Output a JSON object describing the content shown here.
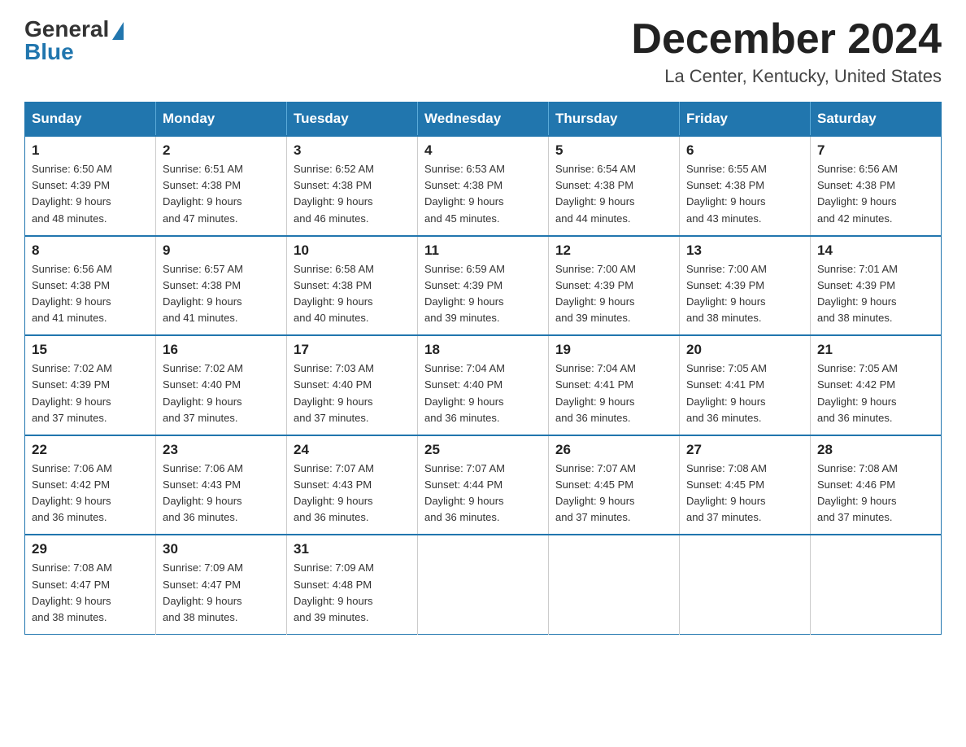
{
  "header": {
    "logo_general": "General",
    "logo_blue": "Blue",
    "title": "December 2024",
    "location": "La Center, Kentucky, United States"
  },
  "days_of_week": [
    "Sunday",
    "Monday",
    "Tuesday",
    "Wednesday",
    "Thursday",
    "Friday",
    "Saturday"
  ],
  "weeks": [
    [
      {
        "day": "1",
        "sunrise": "6:50 AM",
        "sunset": "4:39 PM",
        "daylight": "9 hours and 48 minutes."
      },
      {
        "day": "2",
        "sunrise": "6:51 AM",
        "sunset": "4:38 PM",
        "daylight": "9 hours and 47 minutes."
      },
      {
        "day": "3",
        "sunrise": "6:52 AM",
        "sunset": "4:38 PM",
        "daylight": "9 hours and 46 minutes."
      },
      {
        "day": "4",
        "sunrise": "6:53 AM",
        "sunset": "4:38 PM",
        "daylight": "9 hours and 45 minutes."
      },
      {
        "day": "5",
        "sunrise": "6:54 AM",
        "sunset": "4:38 PM",
        "daylight": "9 hours and 44 minutes."
      },
      {
        "day": "6",
        "sunrise": "6:55 AM",
        "sunset": "4:38 PM",
        "daylight": "9 hours and 43 minutes."
      },
      {
        "day": "7",
        "sunrise": "6:56 AM",
        "sunset": "4:38 PM",
        "daylight": "9 hours and 42 minutes."
      }
    ],
    [
      {
        "day": "8",
        "sunrise": "6:56 AM",
        "sunset": "4:38 PM",
        "daylight": "9 hours and 41 minutes."
      },
      {
        "day": "9",
        "sunrise": "6:57 AM",
        "sunset": "4:38 PM",
        "daylight": "9 hours and 41 minutes."
      },
      {
        "day": "10",
        "sunrise": "6:58 AM",
        "sunset": "4:38 PM",
        "daylight": "9 hours and 40 minutes."
      },
      {
        "day": "11",
        "sunrise": "6:59 AM",
        "sunset": "4:39 PM",
        "daylight": "9 hours and 39 minutes."
      },
      {
        "day": "12",
        "sunrise": "7:00 AM",
        "sunset": "4:39 PM",
        "daylight": "9 hours and 39 minutes."
      },
      {
        "day": "13",
        "sunrise": "7:00 AM",
        "sunset": "4:39 PM",
        "daylight": "9 hours and 38 minutes."
      },
      {
        "day": "14",
        "sunrise": "7:01 AM",
        "sunset": "4:39 PM",
        "daylight": "9 hours and 38 minutes."
      }
    ],
    [
      {
        "day": "15",
        "sunrise": "7:02 AM",
        "sunset": "4:39 PM",
        "daylight": "9 hours and 37 minutes."
      },
      {
        "day": "16",
        "sunrise": "7:02 AM",
        "sunset": "4:40 PM",
        "daylight": "9 hours and 37 minutes."
      },
      {
        "day": "17",
        "sunrise": "7:03 AM",
        "sunset": "4:40 PM",
        "daylight": "9 hours and 37 minutes."
      },
      {
        "day": "18",
        "sunrise": "7:04 AM",
        "sunset": "4:40 PM",
        "daylight": "9 hours and 36 minutes."
      },
      {
        "day": "19",
        "sunrise": "7:04 AM",
        "sunset": "4:41 PM",
        "daylight": "9 hours and 36 minutes."
      },
      {
        "day": "20",
        "sunrise": "7:05 AM",
        "sunset": "4:41 PM",
        "daylight": "9 hours and 36 minutes."
      },
      {
        "day": "21",
        "sunrise": "7:05 AM",
        "sunset": "4:42 PM",
        "daylight": "9 hours and 36 minutes."
      }
    ],
    [
      {
        "day": "22",
        "sunrise": "7:06 AM",
        "sunset": "4:42 PM",
        "daylight": "9 hours and 36 minutes."
      },
      {
        "day": "23",
        "sunrise": "7:06 AM",
        "sunset": "4:43 PM",
        "daylight": "9 hours and 36 minutes."
      },
      {
        "day": "24",
        "sunrise": "7:07 AM",
        "sunset": "4:43 PM",
        "daylight": "9 hours and 36 minutes."
      },
      {
        "day": "25",
        "sunrise": "7:07 AM",
        "sunset": "4:44 PM",
        "daylight": "9 hours and 36 minutes."
      },
      {
        "day": "26",
        "sunrise": "7:07 AM",
        "sunset": "4:45 PM",
        "daylight": "9 hours and 37 minutes."
      },
      {
        "day": "27",
        "sunrise": "7:08 AM",
        "sunset": "4:45 PM",
        "daylight": "9 hours and 37 minutes."
      },
      {
        "day": "28",
        "sunrise": "7:08 AM",
        "sunset": "4:46 PM",
        "daylight": "9 hours and 37 minutes."
      }
    ],
    [
      {
        "day": "29",
        "sunrise": "7:08 AM",
        "sunset": "4:47 PM",
        "daylight": "9 hours and 38 minutes."
      },
      {
        "day": "30",
        "sunrise": "7:09 AM",
        "sunset": "4:47 PM",
        "daylight": "9 hours and 38 minutes."
      },
      {
        "day": "31",
        "sunrise": "7:09 AM",
        "sunset": "4:48 PM",
        "daylight": "9 hours and 39 minutes."
      },
      null,
      null,
      null,
      null
    ]
  ],
  "labels": {
    "sunrise": "Sunrise:",
    "sunset": "Sunset:",
    "daylight": "Daylight:"
  }
}
